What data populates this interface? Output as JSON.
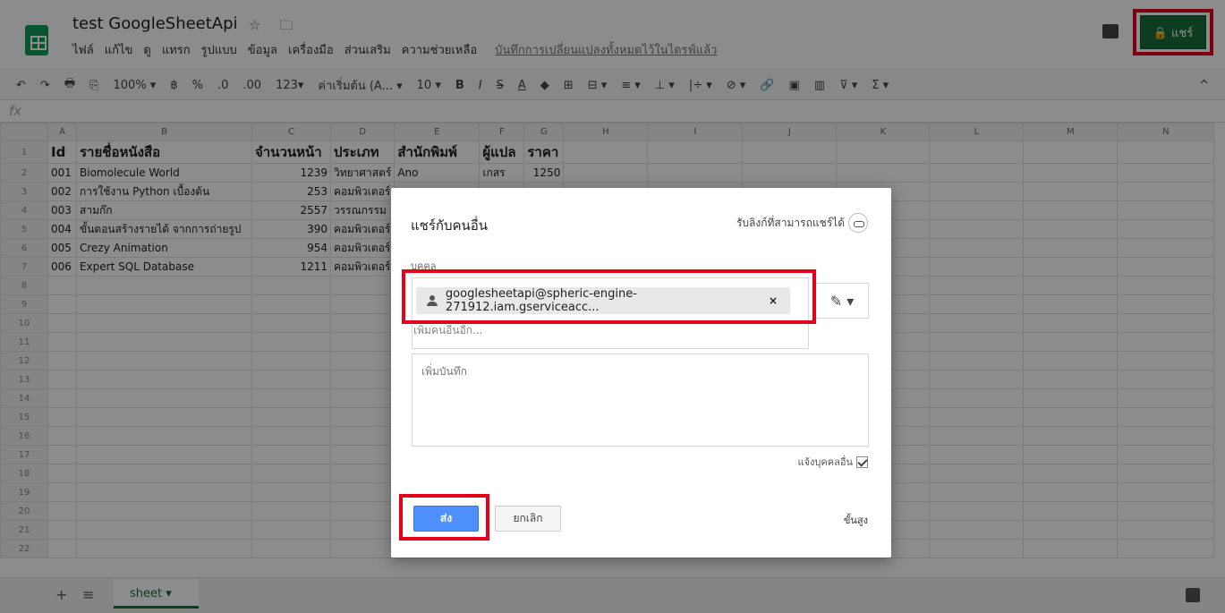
{
  "app": {
    "doc_title": "test GoogleSheetApi",
    "title_icons": "☆ 🗀",
    "menus": [
      "ไฟล์",
      "แก้ไข",
      "ดู",
      "แทรก",
      "รูปแบบ",
      "ข้อมูล",
      "เครื่องมือ",
      "ส่วนเสริม",
      "ความช่วยเหลือ"
    ],
    "saved_status": "บันทึกการเปลี่ยนแปลงทั้งหมดไว้ในไดรฟ์แล้ว",
    "share_label": "🔒 แชร์"
  },
  "toolbar": {
    "items": [
      "↶",
      "↷",
      "🖶",
      "⎘",
      "100% ▾",
      "฿",
      "%",
      ".0",
      ".00",
      "123▾",
      "ค่าเริ่มต้น (A... ▾",
      "10 ▾",
      "B",
      "I",
      "S",
      "A",
      "◆",
      "⊞",
      "⊟ ▾",
      "≡ ▾",
      "⊥ ▾",
      "|÷ ▾",
      "⊘ ▾",
      "🔗",
      "▣",
      "▥",
      "⊽ ▾",
      "Σ ▾"
    ],
    "collapse": "^"
  },
  "formula_bar": {
    "fx": "fx"
  },
  "sheet": {
    "columns": [
      "A",
      "B",
      "C",
      "D",
      "E",
      "F",
      "G",
      "H",
      "I",
      "J",
      "K",
      "L",
      "M",
      "N"
    ],
    "header_row": [
      "Id",
      "รายชื่อหนังสือ",
      "จำนวนหน้า",
      "ประเภท",
      "สำนักพิมพ์",
      "ผู้แปล",
      "ราคา"
    ],
    "rows": [
      [
        "001",
        "Biomolecule World",
        "1239",
        "วิทยาศาสตร์",
        "Ano",
        "เกสร",
        "1250"
      ],
      [
        "002",
        "การใช้งาน Python เบื้องต้น",
        "253",
        "คอมพิวเตอร์",
        "",
        "",
        ""
      ],
      [
        "003",
        "สามก๊ก",
        "2557",
        "วรรณกรรม",
        "",
        "",
        ""
      ],
      [
        "004",
        "ขั้นตอนสร้างรายได้ จากการถ่ายรูป",
        "390",
        "คอมพิวเตอร์",
        "",
        "",
        ""
      ],
      [
        "005",
        "Crezy Animation",
        "954",
        "คอมพิวเตอร์",
        "",
        "",
        ""
      ],
      [
        "006",
        "Expert SQL Database",
        "1211",
        "คอมพิวเตอร์",
        "",
        "",
        ""
      ]
    ],
    "row_numbers": [
      "1",
      "2",
      "3",
      "4",
      "5",
      "6",
      "7",
      "8",
      "9",
      "10",
      "11",
      "12",
      "13",
      "14",
      "15",
      "16",
      "17",
      "18",
      "19",
      "20",
      "21",
      "22"
    ]
  },
  "bottom": {
    "add": "+",
    "list": "≡",
    "tab": "sheet ▾"
  },
  "dialog": {
    "title": "แชร์กับคนอื่น",
    "get_link": "รับลิงก์ที่สามารถแชร์ได้",
    "people_label": "บุคคล",
    "recipient": "googlesheetapi@spheric-engine-271912.iam.gserviceacc...",
    "remove": "×",
    "add_more_placeholder": "เพิ่มคนอื่นอีก...",
    "permission_icon": "✎ ▾",
    "note_placeholder": "เพิ่มบันทึก",
    "notify_label": "แจ้งบุคคลอื่น",
    "send": "ส่ง",
    "cancel": "ยกเลิก",
    "advanced": "ขั้นสูง"
  }
}
